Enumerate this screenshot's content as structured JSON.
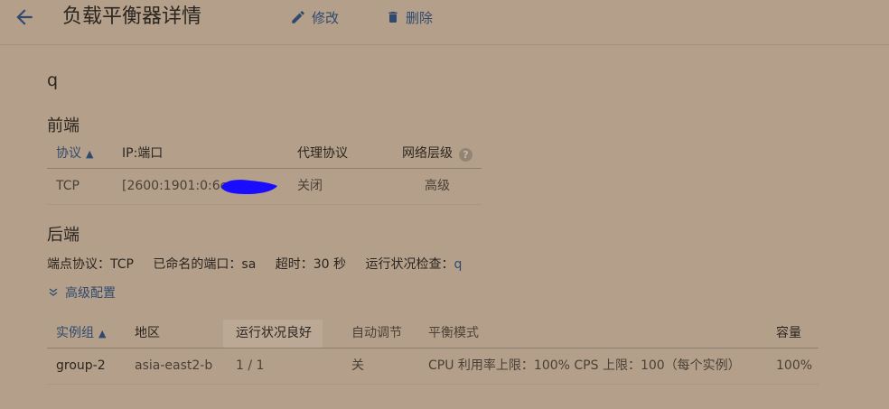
{
  "header": {
    "title": "负载平衡器详情",
    "edit_label": "修改",
    "delete_label": "删除"
  },
  "lb_name": "q",
  "frontend": {
    "title": "前端",
    "columns": {
      "protocol": "协议",
      "ip_port": "IP:端口",
      "proxy": "代理协议",
      "tier": "网络层级"
    },
    "row": {
      "protocol": "TCP",
      "ip_port": "[2600:1901:0:6c",
      "proxy": "关闭",
      "tier": "高级"
    }
  },
  "backend": {
    "title": "后端",
    "endpoint_label": "端点协议：",
    "endpoint_value": "TCP",
    "named_port_label": "已命名的端口：",
    "named_port_value": "sa",
    "timeout_label": "超时：",
    "timeout_value": "30 秒",
    "health_label": "运行状况检查：",
    "health_value": "q",
    "advanced_label": "高级配置",
    "columns": {
      "group": "实例组",
      "region": "地区",
      "health": "运行状况良好",
      "autoscale": "自动调节",
      "mode": "平衡模式",
      "capacity": "容量"
    },
    "row": {
      "group": "group-2",
      "region": "asia-east2-b",
      "health": "1 / 1",
      "autoscale": "关",
      "mode": "CPU 利用率上限：100% CPS 上限：100（每个实例）",
      "capacity": "100%"
    }
  },
  "colors": {
    "background": "#b4a08a",
    "link": "#2f4a6e",
    "redaction": "#1a0dff"
  }
}
